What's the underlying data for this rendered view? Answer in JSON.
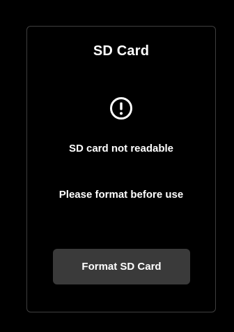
{
  "dialog": {
    "title": "SD Card",
    "icon": "alert-circle-icon",
    "message_primary": "SD card not readable",
    "message_secondary": "Please format before use",
    "format_button_label": "Format SD Card"
  },
  "colors": {
    "background": "#000000",
    "card_border": "#3f3f3f",
    "text": "#ffffff",
    "button_background": "#3a3a3a"
  }
}
